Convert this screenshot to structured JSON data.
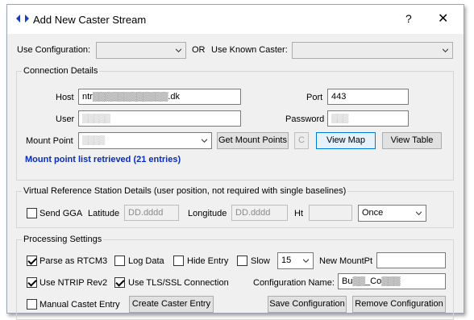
{
  "window": {
    "title": "Add New Caster Stream",
    "help": "?",
    "close": "✕"
  },
  "config_row": {
    "use_configuration_label": "Use Configuration:",
    "or_label": "OR",
    "use_known_caster_label": "Use Known Caster:"
  },
  "connection": {
    "title": "Connection Details",
    "host_label": "Host",
    "host_value": "ntr▒▒▒▒▒▒▒▒▒▒▒▒.dk",
    "port_label": "Port",
    "port_value": "443",
    "user_label": "User",
    "user_value": "▒▒▒▒▒",
    "password_label": "Password",
    "password_value": "▒▒▒",
    "mount_label": "Mount Point",
    "mount_value": "▒▒▒▒",
    "get_mount_points": "Get Mount Points",
    "c_button": "C",
    "view_map": "View Map",
    "view_table": "View Table",
    "status": "Mount point list retrieved (21 entries)"
  },
  "vrs": {
    "title": "Virtual Reference Station Details (user position, not required with single baselines)",
    "send_gga": "Send GGA",
    "latitude_label": "Latitude",
    "latitude_placeholder": "DD.dddd",
    "longitude_label": "Longitude",
    "longitude_placeholder": "DD.dddd",
    "ht_label": "Ht",
    "interval_value": "Once"
  },
  "processing": {
    "title": "Processing Settings",
    "parse_rtcm3": "Parse as RTCM3",
    "log_data": "Log Data",
    "hide_entry": "Hide Entry",
    "slow": "Slow",
    "slow_value": "15",
    "new_mountpt_label": "New MountPt",
    "use_ntrip_rev2": "Use NTRIP Rev2",
    "use_tls": "Use TLS/SSL Connection",
    "config_name_label": "Configuration Name:",
    "config_name_value": "Bu▒▒_Co▒▒▒",
    "manual_castet": "Manual Castet Entry",
    "create_caster": "Create Caster Entry",
    "save_configuration": "Save Configuration",
    "remove_configuration": "Remove Configuration"
  },
  "checks": {
    "send_gga": false,
    "parse_rtcm3": true,
    "log_data": false,
    "hide_entry": false,
    "slow": false,
    "use_ntrip_rev2": true,
    "use_tls": true,
    "manual_castet": false
  }
}
